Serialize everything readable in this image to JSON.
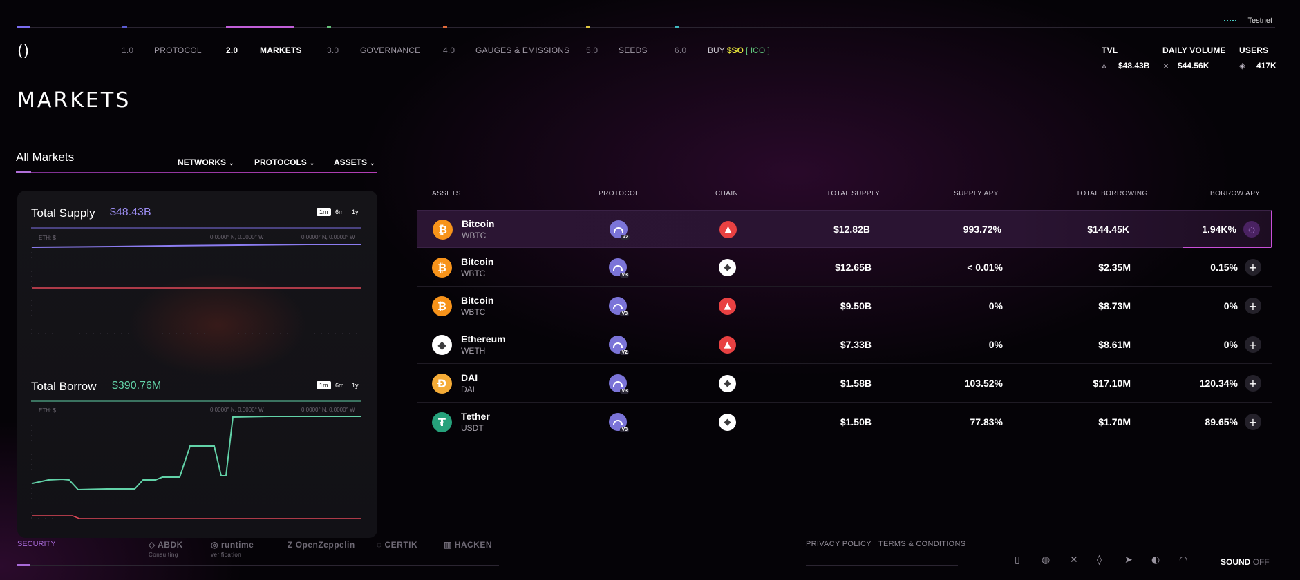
{
  "network": {
    "label": "Testnet"
  },
  "nav": {
    "logo": "()",
    "items": [
      {
        "num": "1.0",
        "label": "PROTOCOL"
      },
      {
        "num": "2.0",
        "label": "MARKETS"
      },
      {
        "num": "3.0",
        "label": "GOVERNANCE"
      },
      {
        "num": "4.0",
        "label": "GAUGES & EMISSIONS"
      },
      {
        "num": "5.0",
        "label": "SEEDS"
      },
      {
        "num": "6.0",
        "label": "BUY"
      }
    ],
    "buy_token": "$SO",
    "buy_tag": "[ ICO ]",
    "active_index": 1,
    "segment_colors": [
      "#7a6df0",
      "#5a5ad0",
      "#c05ed8",
      "#66c27a",
      "#e06a3a",
      "#e0c640",
      "#3fb8c0"
    ]
  },
  "stats": {
    "tvl": {
      "label": "TVL",
      "value": "$48.43B",
      "icon": "tvl-icon"
    },
    "volume": {
      "label": "DAILY VOLUME",
      "value": "$44.56K",
      "icon": "volume-icon"
    },
    "users": {
      "label": "USERS",
      "value": "417K",
      "icon": "users-icon"
    }
  },
  "page": {
    "title": "MARKETS"
  },
  "filters": {
    "tab": "All Markets",
    "networks": "NETWORKS",
    "protocols": "PROTOCOLS",
    "assets": "ASSETS"
  },
  "supply_chart": {
    "title": "Total Supply",
    "value": "$48.43B",
    "value_color": "#9b8cf0",
    "ranges": [
      "1m",
      "6m",
      "1y"
    ],
    "selected_range": "1m",
    "axis_label": "ETH: $",
    "coord_label_1": "0.0000° N, 0.0000° W",
    "coord_label_2": "0.0000° N, 0.0000° W"
  },
  "borrow_chart": {
    "title": "Total Borrow",
    "value": "$390.76M",
    "value_color": "#62d2a8",
    "ranges": [
      "1m",
      "6m",
      "1y"
    ],
    "selected_range": "1m",
    "axis_label": "ETH: $",
    "coord_label_1": "0.0000° N, 0.0000° W",
    "coord_label_2": "0.0000° N, 0.0000° W"
  },
  "table": {
    "headers": {
      "assets": "ASSETS",
      "protocol": "PROTOCOL",
      "chain": "CHAIN",
      "total_supply": "TOTAL SUPPLY",
      "supply_apy": "SUPPLY APY",
      "total_borrowing": "TOTAL BORROWING",
      "borrow_apy": "BORROW APY"
    },
    "rows": [
      {
        "name": "Bitcoin",
        "symbol": "WBTC",
        "icon": "bitcoin-icon",
        "protocol_ver": "V2",
        "chain": "avalanche-icon",
        "total_supply": "$12.82B",
        "supply_apy": "993.72%",
        "total_borrowing": "$144.45K",
        "borrow_apy": "1.94K%"
      },
      {
        "name": "Bitcoin",
        "symbol": "WBTC",
        "icon": "bitcoin-icon",
        "protocol_ver": "V3",
        "chain": "ethereum-icon",
        "total_supply": "$12.65B",
        "supply_apy": "< 0.01%",
        "total_borrowing": "$2.35M",
        "borrow_apy": "0.15%"
      },
      {
        "name": "Bitcoin",
        "symbol": "WBTC",
        "icon": "bitcoin-icon",
        "protocol_ver": "V3",
        "chain": "avalanche-icon",
        "total_supply": "$9.50B",
        "supply_apy": "0%",
        "total_borrowing": "$8.73M",
        "borrow_apy": "0%"
      },
      {
        "name": "Ethereum",
        "symbol": "WETH",
        "icon": "ethereum-icon",
        "protocol_ver": "V2",
        "chain": "avalanche-icon",
        "total_supply": "$7.33B",
        "supply_apy": "0%",
        "total_borrowing": "$8.61M",
        "borrow_apy": "0%"
      },
      {
        "name": "DAI",
        "symbol": "DAI",
        "icon": "dai-icon",
        "protocol_ver": "V3",
        "chain": "ethereum-icon",
        "total_supply": "$1.58B",
        "supply_apy": "103.52%",
        "total_borrowing": "$17.10M",
        "borrow_apy": "120.34%"
      },
      {
        "name": "Tether",
        "symbol": "USDT",
        "icon": "tether-icon",
        "protocol_ver": "V3",
        "chain": "ethereum-icon",
        "total_supply": "$1.50B",
        "supply_apy": "77.83%",
        "total_borrowing": "$1.70M",
        "borrow_apy": "89.65%"
      }
    ]
  },
  "footer": {
    "security": "SECURITY",
    "auditors": [
      {
        "name": "ABDK",
        "sub": "Consulting"
      },
      {
        "name": "runtime",
        "sub": "verification"
      },
      {
        "name": "OpenZeppelin",
        "sub": ""
      },
      {
        "name": "CERTIK",
        "sub": ""
      },
      {
        "name": "HACKEN",
        "sub": ""
      }
    ],
    "privacy": "PRIVACY POLICY",
    "terms": "TERMS & CONDITIONS",
    "sound_label": "SOUND",
    "sound_state": "OFF",
    "social_icons": [
      "docs-icon",
      "discord-icon",
      "x-icon",
      "gitbook-icon",
      "telegram-icon",
      "github-icon",
      "medium-icon"
    ]
  }
}
